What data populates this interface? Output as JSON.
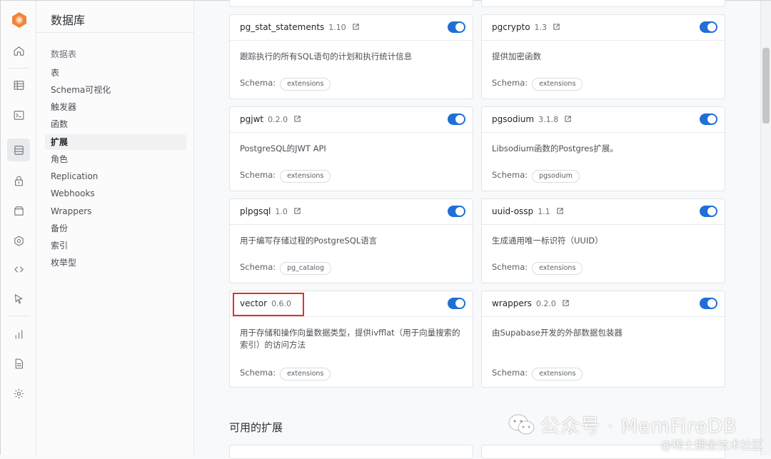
{
  "sidebar": {
    "title": "数据库",
    "section": "数据表",
    "items": [
      "表",
      "Schema可视化",
      "触发器",
      "函数",
      "扩展",
      "角色",
      "Replication",
      "Webhooks",
      "Wrappers",
      "备份",
      "索引",
      "枚举型"
    ],
    "active_index": 4
  },
  "extensions": [
    {
      "name": "pg_stat_statements",
      "version": "1.10",
      "enabled": true,
      "description": "跟踪执行的所有SQL语句的计划和执行统计信息",
      "schema_label": "Schema:",
      "schema": "extensions"
    },
    {
      "name": "pgcrypto",
      "version": "1.3",
      "enabled": true,
      "description": "提供加密函数",
      "schema_label": "Schema:",
      "schema": "extensions"
    },
    {
      "name": "pgjwt",
      "version": "0.2.0",
      "enabled": true,
      "description": "PostgreSQL的JWT API",
      "schema_label": "Schema:",
      "schema": "extensions"
    },
    {
      "name": "pgsodium",
      "version": "3.1.8",
      "enabled": true,
      "description": "Libsodium函数的Postgres扩展。",
      "schema_label": "Schema:",
      "schema": "pgsodium"
    },
    {
      "name": "plpgsql",
      "version": "1.0",
      "enabled": true,
      "description": "用于编写存储过程的PostgreSQL语言",
      "schema_label": "Schema:",
      "schema": "pg_catalog"
    },
    {
      "name": "uuid-ossp",
      "version": "1.1",
      "enabled": true,
      "description": "生成通用唯一标识符（UUID）",
      "schema_label": "Schema:",
      "schema": "extensions"
    },
    {
      "name": "vector",
      "version": "0.6.0",
      "enabled": true,
      "description": "用于存储和操作向量数据类型，提供ivfflat（用于向量搜索的索引）的访问方法",
      "schema_label": "Schema:",
      "schema": "extensions"
    },
    {
      "name": "wrappers",
      "version": "0.2.0",
      "enabled": true,
      "description": "由Supabase开发的外部数据包装器",
      "schema_label": "Schema:",
      "schema": "extensions"
    }
  ],
  "available_section_title": "可用的扩展",
  "watermark": {
    "main": "公众号 · MemFireDB",
    "corner": "@稀土掘金技术社区"
  },
  "colors": {
    "toggle_on": "#1f6fd6",
    "highlight_box": "#e0312b",
    "logo": "#f0843a"
  }
}
